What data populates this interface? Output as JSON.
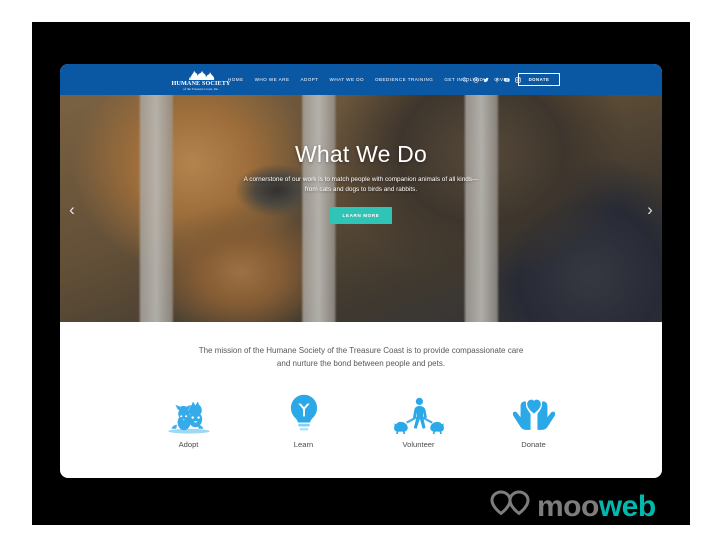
{
  "theme": {
    "nav_blue": "#0a57a4",
    "accent_teal": "#2ec4b6",
    "icon_blue": "#2aa8e8",
    "frame_black": "#000000",
    "card_white": "#ffffff",
    "body_text": "#58585a"
  },
  "nav": {
    "logo": {
      "mark": "humane-society-logo-mark",
      "title": "HUMANE SOCIETY",
      "subtitle": "of the Treasure Coast, Inc."
    },
    "menu": [
      {
        "label": "HOME"
      },
      {
        "label": "WHO WE ARE"
      },
      {
        "label": "ADOPT"
      },
      {
        "label": "WHAT WE DO"
      },
      {
        "label": "OBEDIENCE TRAINING"
      },
      {
        "label": "GET INVOLVED"
      },
      {
        "label": "GIVE"
      }
    ],
    "icons": [
      {
        "name": "search-icon"
      },
      {
        "name": "gear-icon"
      },
      {
        "name": "twitter-icon"
      },
      {
        "name": "facebook-icon"
      },
      {
        "name": "youtube-icon"
      },
      {
        "name": "instagram-icon"
      }
    ],
    "donate_label": "DONATE"
  },
  "hero": {
    "title": "What We Do",
    "subtitle": "A cornerstone of our work is to match people with companion animals of all kinds—from cats and dogs to birds and rabbits.",
    "cta_label": "LEARN MORE",
    "prev_arrow": "‹",
    "next_arrow": "›",
    "image_alt": "orange tabby cat behind kennel bars"
  },
  "mission": {
    "text": "The mission of the Humane Society of the Treasure Coast is to provide compassionate care and nurture the bond between people and pets."
  },
  "quicklinks": [
    {
      "label": "Adopt",
      "icon": "cat-and-dog-icon"
    },
    {
      "label": "Learn",
      "icon": "lightbulb-icon"
    },
    {
      "label": "Volunteer",
      "icon": "person-walking-dogs-icon"
    },
    {
      "label": "Donate",
      "icon": "hands-holding-heart-icon"
    }
  ],
  "watermark": {
    "text_part_1": "moo",
    "text_part_2": "web",
    "mark": "heart-logo-mark"
  }
}
